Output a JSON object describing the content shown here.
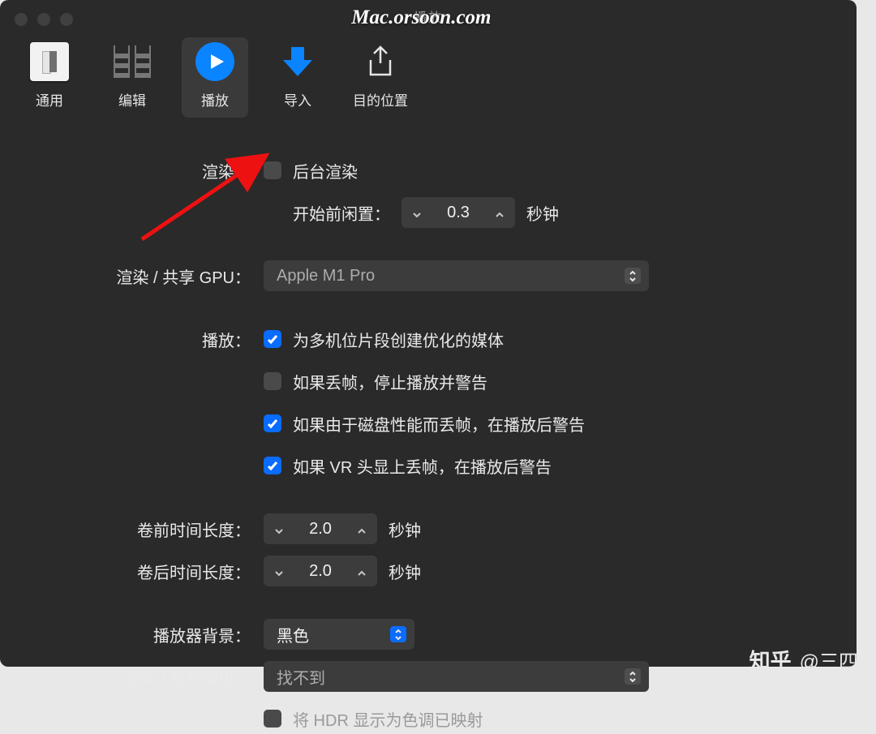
{
  "watermark": "Mac.orsoon.com",
  "window_title": "播放",
  "toolbar": [
    "通用",
    "编辑",
    "播放",
    "导入",
    "目的位置"
  ],
  "render": {
    "label": "渲染：",
    "bg_label": "后台渲染",
    "idle_label": "开始前闲置：",
    "idle_value": "0.3",
    "unit": "秒钟"
  },
  "gpu": {
    "label": "渲染 / 共享 GPU：",
    "value": "Apple M1 Pro"
  },
  "playback": {
    "label": "播放：",
    "opt1": "为多机位片段创建优化的媒体",
    "opt2": "如果丢帧，停止播放并警告",
    "opt3": "如果由于磁盘性能而丢帧，在播放后警告",
    "opt4": "如果 VR 头显上丢帧，在播放后警告"
  },
  "preroll": {
    "label": "卷前时间长度：",
    "value": "2.0",
    "unit": "秒钟"
  },
  "postroll": {
    "label": "卷后时间长度：",
    "value": "2.0",
    "unit": "秒钟"
  },
  "playerbg": {
    "label": "播放器背景：",
    "value": "黑色"
  },
  "avout": {
    "label": "音频 / 视频输出：",
    "value": "找不到",
    "hdr": "将 HDR 显示为色调已映射"
  },
  "author": "@三四"
}
